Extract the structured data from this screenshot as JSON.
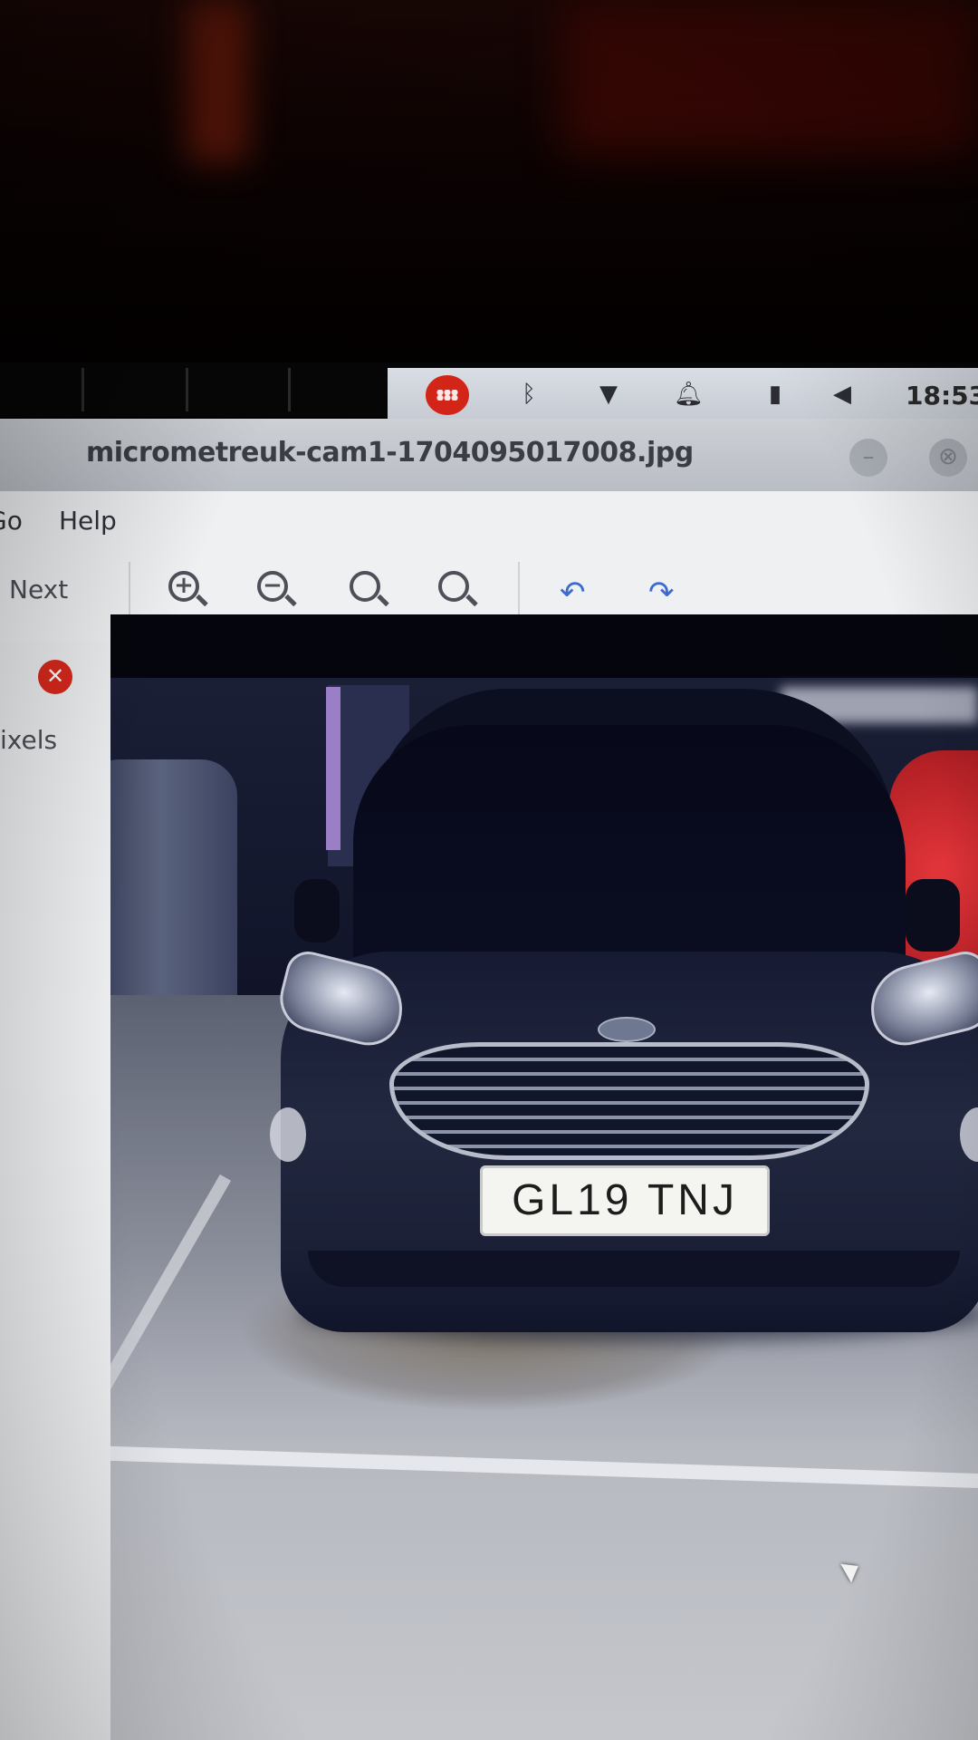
{
  "window": {
    "title": "micrometreuk-cam1-1704095017008.jpg",
    "minimize_glyph": "–",
    "close_glyph": "⊗"
  },
  "tray": {
    "clock": "18:53",
    "icons": [
      "apps-icon",
      "bluetooth-icon",
      "wifi-icon",
      "bell-icon",
      "battery-icon",
      "volume-icon"
    ]
  },
  "menu": {
    "go": "Go",
    "help": "Help"
  },
  "toolbar": {
    "next": "Next",
    "zoom_in": "+",
    "zoom_out": "−",
    "zoom_normal": "",
    "zoom_fit": "",
    "rotate_left": "↶",
    "rotate_right": "↷"
  },
  "side_panel": {
    "close_glyph": "✕",
    "label": "ixels"
  },
  "image": {
    "plate_text": "GL19 TNJ"
  },
  "colors": {
    "close_red": "#d8281c",
    "apps_red": "#d32418",
    "rotate_blue": "#3b6bd0"
  }
}
